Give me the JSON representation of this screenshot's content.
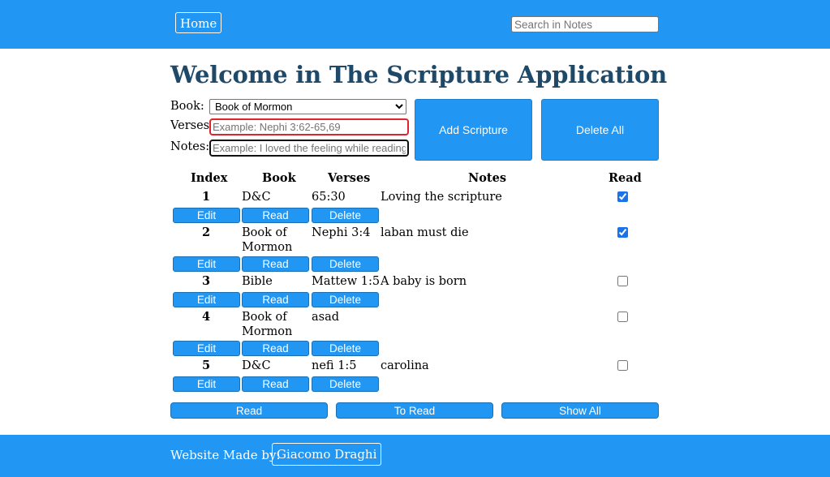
{
  "header": {
    "home_label": "Home",
    "search_placeholder": "Search in Notes"
  },
  "title": "Welcome in The Scripture Application",
  "form": {
    "book_label": "Book:",
    "book_selected": "Book of Mormon",
    "verses_label": "Verses:",
    "verses_placeholder": "Example: Nephi 3:62-65,69",
    "notes_label": "Notes:",
    "notes_placeholder": "Example: I loved the feeling while reading",
    "add_label": "Add Scripture",
    "delete_all_label": "Delete All"
  },
  "table": {
    "headers": [
      "Index",
      "Book",
      "Verses",
      "Notes",
      "Read"
    ],
    "rows": [
      {
        "index": "1",
        "book": "D&C",
        "verses": "65:30",
        "notes": "Loving the scripture",
        "read": true
      },
      {
        "index": "2",
        "book": "Book of Mormon",
        "verses": "Nephi 3:4",
        "notes": "laban must die",
        "read": true
      },
      {
        "index": "3",
        "book": "Bible",
        "verses": "Mattew 1:5",
        "notes": "A baby is born",
        "read": false
      },
      {
        "index": "4",
        "book": "Book of Mormon",
        "verses": "asad",
        "notes": "",
        "read": false
      },
      {
        "index": "5",
        "book": "D&C",
        "verses": "nefi 1:5",
        "notes": "carolina",
        "read": false
      }
    ],
    "row_actions": {
      "edit": "Edit",
      "read": "Read",
      "delete": "Delete"
    }
  },
  "filters": {
    "read": "Read",
    "to_read": "To Read",
    "show_all": "Show All"
  },
  "footer": {
    "label": "Website Made by:",
    "author": "Giacomo Draghi"
  },
  "colors": {
    "accent": "#2196F3",
    "title": "#1F4968"
  }
}
